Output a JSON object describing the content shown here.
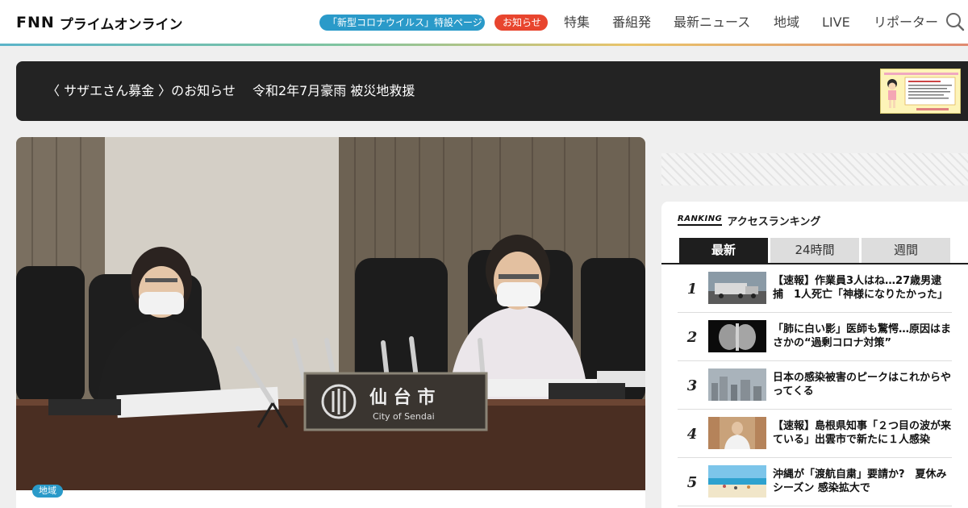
{
  "header": {
    "logo_main": "FNN",
    "logo_sub": "プライムオンライン",
    "pill_corona": "「新型コロナウイルス」特設ページ",
    "pill_notice": "お知らせ",
    "nav": [
      "特集",
      "番組発",
      "最新ニュース",
      "地域",
      "LIVE",
      "リポーター"
    ]
  },
  "banner": {
    "text": "〈 サザエさん募金 〉のお知らせ　 令和2年7月豪雨 被災地救援"
  },
  "main": {
    "region_badge": "地域",
    "nameplate_ja": "仙 台 市",
    "nameplate_en": "City of Sendai"
  },
  "ranking": {
    "label_en": "RANKING",
    "label_ja": "アクセスランキング",
    "tabs": [
      "最新",
      "24時間",
      "週間"
    ],
    "items": [
      {
        "rank": "1",
        "title": "【速報】作業員3人はね…27歳男逮捕　1人死亡「神様になりたかった」"
      },
      {
        "rank": "2",
        "title": "「肺に白い影」医師も驚愕…原因はまさかの“過剰コロナ対策”"
      },
      {
        "rank": "3",
        "title": "日本の感染被害のピークはこれからやってくる"
      },
      {
        "rank": "4",
        "title": "【速報】島根県知事「２つ目の波が来ている」出雲市で新たに１人感染"
      },
      {
        "rank": "5",
        "title": "沖縄が「渡航自粛」要請か?　夏休みシーズン 感染拡大で"
      }
    ]
  },
  "colors": {
    "accent_blue": "#2a9ac9",
    "accent_red": "#e8452e",
    "dark": "#232323"
  }
}
